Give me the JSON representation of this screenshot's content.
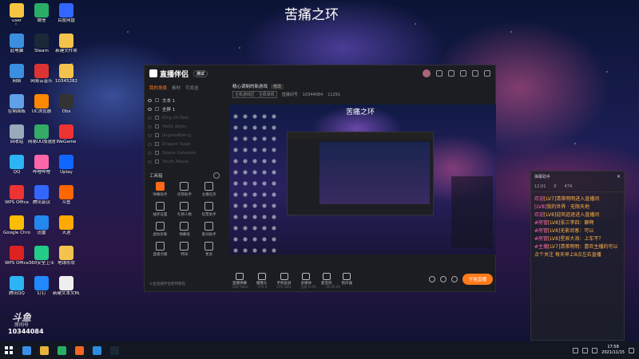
{
  "desktop": {
    "title": "苦痛之环",
    "icons": [
      {
        "label": "user",
        "color": "#f5c542"
      },
      {
        "label": "此电脑",
        "color": "#3b8fe0"
      },
      {
        "label": "网络",
        "color": "#3b8fe0"
      },
      {
        "label": "控制面板",
        "color": "#5fa0e8"
      },
      {
        "label": "回收站",
        "color": "#9ab"
      },
      {
        "label": "QQ",
        "color": "#2cb5f5"
      },
      {
        "label": "WPS Office",
        "color": "#e33"
      },
      {
        "label": "Google Chrome",
        "color": "#fbbc05"
      },
      {
        "label": "WPS Office",
        "color": "#d22"
      },
      {
        "label": "腾讯QQ",
        "color": "#2cb5f5"
      },
      {
        "label": "微信",
        "color": "#2aae67"
      },
      {
        "label": "Steam",
        "color": "#1b2838"
      },
      {
        "label": "网易云音乐",
        "color": "#d33"
      },
      {
        "label": "UC浏览器",
        "color": "#f80"
      },
      {
        "label": "网易UU加速器",
        "color": "#3a6"
      },
      {
        "label": "哔哩哔哩",
        "color": "#f6a"
      },
      {
        "label": "腾讯会议",
        "color": "#36f"
      },
      {
        "label": "迅雷",
        "color": "#28e"
      },
      {
        "label": "360安全卫士",
        "color": "#2c8"
      },
      {
        "label": "钉钉",
        "color": "#28f"
      },
      {
        "label": "百度网盘",
        "color": "#36f"
      },
      {
        "label": "新建文件夹",
        "color": "#f3c34d"
      },
      {
        "label": "10345282",
        "color": "#f3c34d"
      },
      {
        "label": "Obs",
        "color": "#333"
      },
      {
        "label": "WeGame",
        "color": "#e33"
      },
      {
        "label": "Uplay",
        "color": "#16f"
      },
      {
        "label": "斗鱼",
        "color": "#f60"
      },
      {
        "label": "天涯",
        "color": "#fa0"
      },
      {
        "label": "地球形状",
        "color": "#f3c34d"
      },
      {
        "label": "新建文本文档.txt",
        "color": "#eee"
      }
    ],
    "watermark": {
      "logo": "斗鱼",
      "sub": "房间号",
      "room_id": "10344084"
    }
  },
  "app": {
    "logo": "直播伴侣",
    "beta": "测试",
    "left_tabs": [
      "我的场景",
      "素材",
      "可发送"
    ],
    "scenes": [
      {
        "name": "文本 1",
        "visible": true
      },
      {
        "name": "全屏 1",
        "visible": true
      },
      {
        "name": "King Of Pain",
        "visible": false
      },
      {
        "name": "Hello dojos",
        "visible": false
      },
      {
        "name": "jingeleAbeng",
        "visible": false
      },
      {
        "name": "Dragon Saga",
        "visible": false
      },
      {
        "name": "Space Galaxies",
        "visible": false
      },
      {
        "name": "Youth Abyss",
        "visible": false
      }
    ],
    "tools_title": "工具箱",
    "tools": [
      {
        "label": "弹幕助手",
        "accent": true
      },
      {
        "label": "房管助手",
        "accent": false
      },
      {
        "label": "主播任务",
        "accent": false
      },
      {
        "label": "抽奖设置",
        "accent": false
      },
      {
        "label": "礼物人数",
        "accent": false
      },
      {
        "label": "投票助手",
        "accent": false
      },
      {
        "label": "虚拟形象",
        "accent": false
      },
      {
        "label": "弹幕墙",
        "accent": false
      },
      {
        "label": "歌词助手",
        "accent": false
      },
      {
        "label": "直播点播",
        "accent": false
      },
      {
        "label": "特效",
        "accent": false
      },
      {
        "label": "更多",
        "accent": false
      }
    ],
    "left_footer": "斗鱼直播伴侣使用教程",
    "stream": {
      "title": "精心调制的新游戏",
      "edit": "修改",
      "category": "主机游戏区 · 主机单机",
      "room_label": "直播间号",
      "room_id": "10344084",
      "heat": "11291"
    },
    "preview_title": "苦痛之环",
    "controls": [
      "直播弹幕",
      "摄像头",
      "手机投屏",
      "多媒体",
      "麦克风",
      "扬声器"
    ],
    "go_live": "开始直播",
    "status": [
      "码率 0kb/s",
      "FPS 0",
      "CPU 18%",
      "丢帧 0.0%",
      "00:00:00"
    ]
  },
  "chat": {
    "title": "弹幕助手",
    "stats": {
      "time": "12:01",
      "likes": "0",
      "count": "474"
    },
    "messages": [
      {
        "prefix": "欢迎",
        "text": "[LV7]清茶明明进入直播间"
      },
      {
        "prefix": "[LV8]",
        "text": "我的世界 · 无限天地"
      },
      {
        "prefix": "欢迎",
        "text": "[LV8]迎风追逐进入直播间"
      },
      {
        "prefix": "#房管",
        "text": "[LV8]张三李四：聊啊"
      },
      {
        "prefix": "#房管",
        "text": "[LV8]无影剑客：可以"
      },
      {
        "prefix": "#房管",
        "text": "[LV8]星辰大海：上车不？"
      },
      {
        "prefix": "#主播",
        "text": "[LV7]清茶明明：喜欢主播的可以"
      },
      {
        "prefix": "",
        "text": "点个关注 每天早上8点左右直播"
      }
    ]
  },
  "taskbar": {
    "apps": [
      "#3a8ee6",
      "#e8b43a",
      "#2aae67",
      "#f26522",
      "#2c8ce0",
      "#1b2838"
    ],
    "time": "17:58",
    "date": "2021/11/15"
  }
}
